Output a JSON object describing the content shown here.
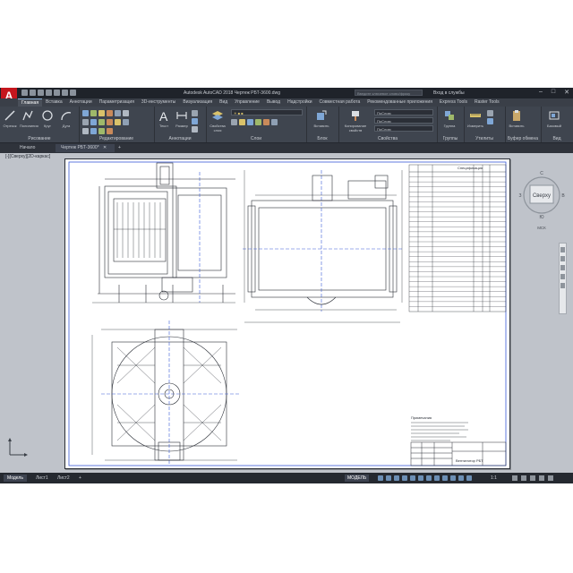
{
  "app": {
    "logo": "A",
    "title": "Autodesk AutoCAD 2018   Чертеж РБТ-3600.dwg",
    "search_placeholder": "Введите ключевое слово/фразу",
    "user": "Вход в службы",
    "window_controls": [
      "–",
      "□",
      "✕"
    ]
  },
  "tabs": [
    "Главная",
    "Вставка",
    "Аннотации",
    "Параметризация",
    "3D-инструменты",
    "Визуализация",
    "Вид",
    "Управление",
    "Вывод",
    "Надстройки",
    "Совместная работа",
    "Рекомендованные приложения",
    "Express Tools",
    "Raster Tools"
  ],
  "active_tab_index": 0,
  "ribbon": {
    "draw": {
      "label": "Рисование",
      "buttons": [
        "Отрезок",
        "Полилиния",
        "Круг",
        "Дуга"
      ]
    },
    "modify": {
      "label": "Редактирование"
    },
    "annotation": {
      "label": "Аннотации",
      "buttons": [
        "Текст",
        "Размер"
      ]
    },
    "layers": {
      "label": "Слои",
      "buttons": [
        "Свойства слоя"
      ]
    },
    "block": {
      "label": "Блок",
      "buttons": [
        "Вставить"
      ]
    },
    "properties": {
      "label": "Свойства",
      "buttons": [
        "Копирование свойств"
      ],
      "dropdowns": [
        "ПоСлою",
        "ПоСлою",
        "ПоСлою"
      ]
    },
    "groups": {
      "label": "Группы",
      "buttons": [
        "Группа"
      ]
    },
    "utilities": {
      "label": "Утилиты",
      "buttons": [
        "Измерить"
      ]
    },
    "clipboard": {
      "label": "Буфер обмена",
      "buttons": [
        "Вставить"
      ]
    },
    "view": {
      "label": "Вид",
      "buttons": [
        "Базовый"
      ]
    }
  },
  "file_tabs": [
    "Начало",
    "Чертеж РБТ-3600*"
  ],
  "viewport_label": "[-][Сверху][2D-каркас]",
  "viewcube": {
    "compass": [
      "С",
      "В",
      "Ю",
      "З"
    ],
    "face": "Сверху",
    "wcs": "МСК"
  },
  "drawing": {
    "table_title": "Спецификация",
    "table_rows": 28,
    "notes_heading": "Примечания",
    "stamp_name": "Вентилятор РБТ"
  },
  "status": {
    "layout_tabs": [
      "Модель",
      "Лист1",
      "Лист2"
    ],
    "active_layout": 0,
    "add_tab": "+",
    "model_label": "МОДЕЛЬ",
    "scale": "1:1"
  },
  "colors": {
    "accent": "#c5161d",
    "ribbon": "#3f454f",
    "canvas": "#bfc3ca",
    "drawing_line": "#2a2e36",
    "frame_blue": "#3b5bd8"
  }
}
